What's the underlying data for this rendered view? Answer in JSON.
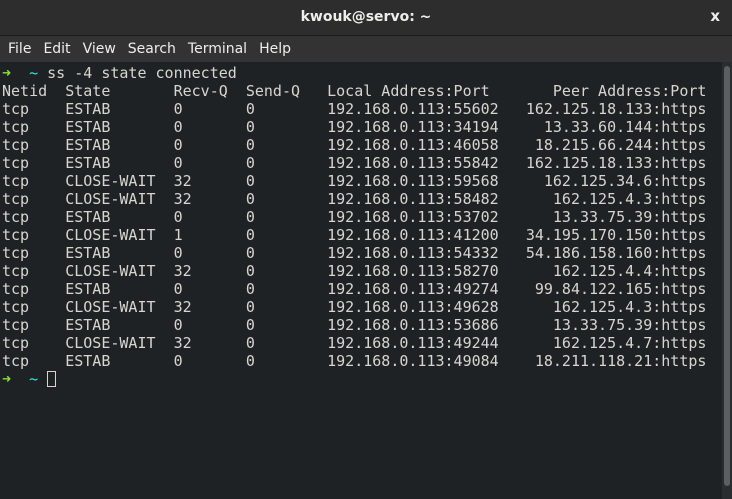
{
  "window": {
    "title": "kwouk@servo: ~",
    "close_label": "x"
  },
  "menu": [
    "File",
    "Edit",
    "View",
    "Search",
    "Terminal",
    "Help"
  ],
  "terminal": {
    "prompt_arrow": "➜",
    "prompt_dir": "~",
    "command": "ss -4 state connected",
    "headers": [
      "Netid",
      "State",
      "Recv-Q",
      "Send-Q",
      "Local Address:Port",
      "Peer Address:Port"
    ],
    "rows": [
      [
        "tcp",
        "ESTAB",
        "0",
        "0",
        "192.168.0.113:55602",
        "162.125.18.133:https"
      ],
      [
        "tcp",
        "ESTAB",
        "0",
        "0",
        "192.168.0.113:34194",
        "13.33.60.144:https"
      ],
      [
        "tcp",
        "ESTAB",
        "0",
        "0",
        "192.168.0.113:46058",
        "18.215.66.244:https"
      ],
      [
        "tcp",
        "ESTAB",
        "0",
        "0",
        "192.168.0.113:55842",
        "162.125.18.133:https"
      ],
      [
        "tcp",
        "CLOSE-WAIT",
        "32",
        "0",
        "192.168.0.113:59568",
        "162.125.34.6:https"
      ],
      [
        "tcp",
        "CLOSE-WAIT",
        "32",
        "0",
        "192.168.0.113:58482",
        "162.125.4.3:https"
      ],
      [
        "tcp",
        "ESTAB",
        "0",
        "0",
        "192.168.0.113:53702",
        "13.33.75.39:https"
      ],
      [
        "tcp",
        "CLOSE-WAIT",
        "1",
        "0",
        "192.168.0.113:41200",
        "34.195.170.150:https"
      ],
      [
        "tcp",
        "ESTAB",
        "0",
        "0",
        "192.168.0.113:54332",
        "54.186.158.160:https"
      ],
      [
        "tcp",
        "CLOSE-WAIT",
        "32",
        "0",
        "192.168.0.113:58270",
        "162.125.4.4:https"
      ],
      [
        "tcp",
        "ESTAB",
        "0",
        "0",
        "192.168.0.113:49274",
        "99.84.122.165:https"
      ],
      [
        "tcp",
        "CLOSE-WAIT",
        "32",
        "0",
        "192.168.0.113:49628",
        "162.125.4.3:https"
      ],
      [
        "tcp",
        "ESTAB",
        "0",
        "0",
        "192.168.0.113:53686",
        "13.33.75.39:https"
      ],
      [
        "tcp",
        "CLOSE-WAIT",
        "32",
        "0",
        "192.168.0.113:49244",
        "162.125.4.7:https"
      ],
      [
        "tcp",
        "ESTAB",
        "0",
        "0",
        "192.168.0.113:49084",
        "18.211.118.21:https"
      ]
    ]
  }
}
